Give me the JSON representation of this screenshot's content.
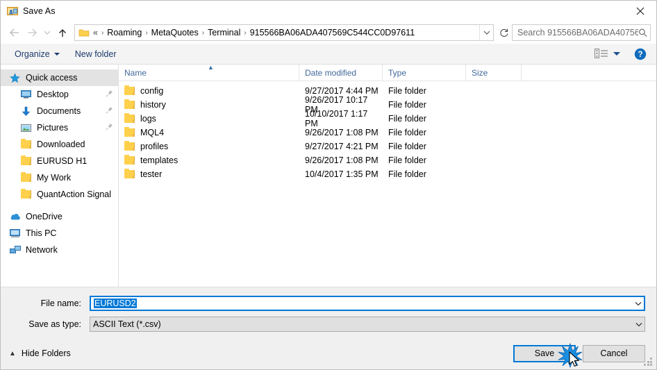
{
  "window": {
    "title": "Save As",
    "title_icon": "save-as-icon",
    "close_icon": "close-icon"
  },
  "nav": {
    "back_icon": "arrow-left-icon",
    "forward_icon": "arrow-right-icon",
    "history_icon": "chevron-down-icon",
    "up_icon": "arrow-up-icon",
    "refresh_icon": "refresh-icon",
    "address_dropdown_icon": "chevron-down-icon",
    "folder_icon": "folder-icon",
    "breadcrumbs": [
      {
        "label": "«"
      },
      {
        "label": "Roaming"
      },
      {
        "label": "MetaQuotes"
      },
      {
        "label": "Terminal"
      },
      {
        "label": "915566BA06ADA407569C544CC0D97611"
      }
    ],
    "separator": "›"
  },
  "search": {
    "placeholder": "Search 915566BA06ADA40756...",
    "icon": "search-icon"
  },
  "toolbar": {
    "organize_label": "Organize",
    "new_folder_label": "New folder",
    "view_icon": "view-options-icon",
    "view_caret_icon": "chevron-down-icon",
    "help_icon": "help-icon"
  },
  "sidebar": {
    "items": [
      {
        "label": "Quick access",
        "icon": "star-icon",
        "selected": true,
        "indent": false,
        "pinned": false
      },
      {
        "label": "Desktop",
        "icon": "desktop-icon",
        "selected": false,
        "indent": true,
        "pinned": true
      },
      {
        "label": "Documents",
        "icon": "documents-icon",
        "selected": false,
        "indent": true,
        "pinned": true
      },
      {
        "label": "Pictures",
        "icon": "pictures-icon",
        "selected": false,
        "indent": true,
        "pinned": true
      },
      {
        "label": "Downloaded",
        "icon": "folder-icon",
        "selected": false,
        "indent": true,
        "pinned": false
      },
      {
        "label": "EURUSD H1",
        "icon": "folder-icon",
        "selected": false,
        "indent": true,
        "pinned": false
      },
      {
        "label": "My Work",
        "icon": "folder-icon",
        "selected": false,
        "indent": true,
        "pinned": false
      },
      {
        "label": "QuantAction Signal",
        "icon": "folder-icon",
        "selected": false,
        "indent": true,
        "pinned": false
      },
      {
        "label": "OneDrive",
        "icon": "onedrive-icon",
        "selected": false,
        "indent": false,
        "pinned": false
      },
      {
        "label": "This PC",
        "icon": "this-pc-icon",
        "selected": false,
        "indent": false,
        "pinned": false
      },
      {
        "label": "Network",
        "icon": "network-icon",
        "selected": false,
        "indent": false,
        "pinned": false
      }
    ]
  },
  "filelist": {
    "columns": [
      "Name",
      "Date modified",
      "Type",
      "Size"
    ],
    "sort_column": "Name",
    "sort_direction": "ascending",
    "sort_icon": "caret-up-icon",
    "rows": [
      {
        "name": "config",
        "date": "9/27/2017 4:44 PM",
        "type": "File folder",
        "size": ""
      },
      {
        "name": "history",
        "date": "9/26/2017 10:17 PM",
        "type": "File folder",
        "size": ""
      },
      {
        "name": "logs",
        "date": "10/10/2017 1:17 PM",
        "type": "File folder",
        "size": ""
      },
      {
        "name": "MQL4",
        "date": "9/26/2017 1:08 PM",
        "type": "File folder",
        "size": ""
      },
      {
        "name": "profiles",
        "date": "9/27/2017 4:21 PM",
        "type": "File folder",
        "size": ""
      },
      {
        "name": "templates",
        "date": "9/26/2017 1:08 PM",
        "type": "File folder",
        "size": ""
      },
      {
        "name": "tester",
        "date": "10/4/2017 1:35 PM",
        "type": "File folder",
        "size": ""
      }
    ]
  },
  "form": {
    "file_name_label": "File name:",
    "file_name_value": "EURUSD2",
    "file_name_selected": true,
    "save_as_type_label": "Save as type:",
    "save_as_type_value": "ASCII Text (*.csv)",
    "dropdown_icon": "chevron-down-icon"
  },
  "footer": {
    "hide_folders_label": "Hide Folders",
    "hide_folders_icon": "chevron-up-icon",
    "save_label": "Save",
    "cancel_label": "Cancel",
    "save_is_default": true,
    "click_indicator": "click-starburst",
    "cursor_icon": "mouse-pointer-icon",
    "resize_grip": "resize-grip-icon"
  },
  "colors": {
    "accent": "#0078d7",
    "folder": "#ffd04b",
    "header_text": "#41699b",
    "toolbar_link": "#1b3a6b",
    "selection": "#e3e3e3"
  }
}
